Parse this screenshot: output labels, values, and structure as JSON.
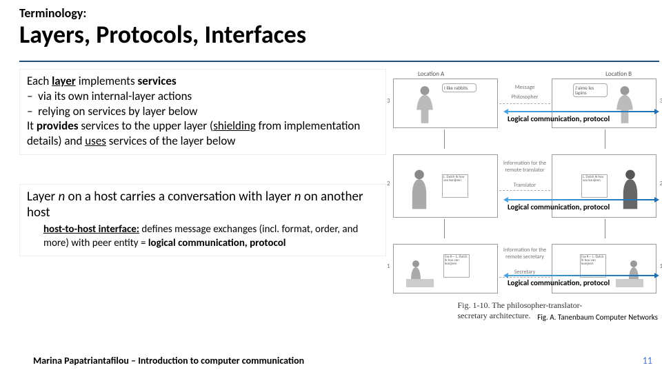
{
  "header": {
    "pre": "Terminology:",
    "title": "Layers, Protocols, Interfaces"
  },
  "box1": {
    "l1a": "Each ",
    "l1b": "layer",
    "l1c": " implements ",
    "l1d": "services",
    "b1": "via its own internal-layer actions",
    "b2": "relying on services by layer below",
    "l2a": "It ",
    "l2b": "provides",
    "l2c": " services to the upper layer (",
    "l2d": "shielding",
    "l2e": " from implementation details) and ",
    "l2f": "uses",
    "l2g": " services of the layer below"
  },
  "box2": {
    "lead_a": "Layer ",
    "lead_n": "n",
    "lead_b": " on a host carries a conversation with layer ",
    "lead_n2": "n",
    "lead_c": " on another host",
    "sub_a": "host-to-host interface:",
    "sub_b": " defines message exchanges (incl. format, order, and more) with peer entity = ",
    "sub_c": "logical communication, protocol"
  },
  "fig": {
    "locA": "Location A",
    "locB": "Location B",
    "bubA": "I like rabbits",
    "bubB": "J'aime les lapins",
    "msg": "Message",
    "phil": "Philosopher",
    "info1": "Information for the remote translator",
    "trans": "Translator",
    "noteA2": "L. Dutch Ik hou van konijnen",
    "noteB2": "L. Dutch Ik hou van konijnen",
    "info2": "Information for the remote secretary",
    "sec": "Secretary",
    "fax": "Fax #— L. Dutch Ik hou van konijnen",
    "log": "Logical communication, protocol",
    "caption": "Fig. 1-10. The philosopher-translator-secretary architecture.",
    "attr": "Fig. A. Tanenbaum Computer Networks",
    "nums": {
      "l1": "3",
      "l2": "2",
      "l3": "1"
    }
  },
  "footer": {
    "text": "Marina Papatriantafilou – Introduction to computer communication",
    "page": "11"
  }
}
